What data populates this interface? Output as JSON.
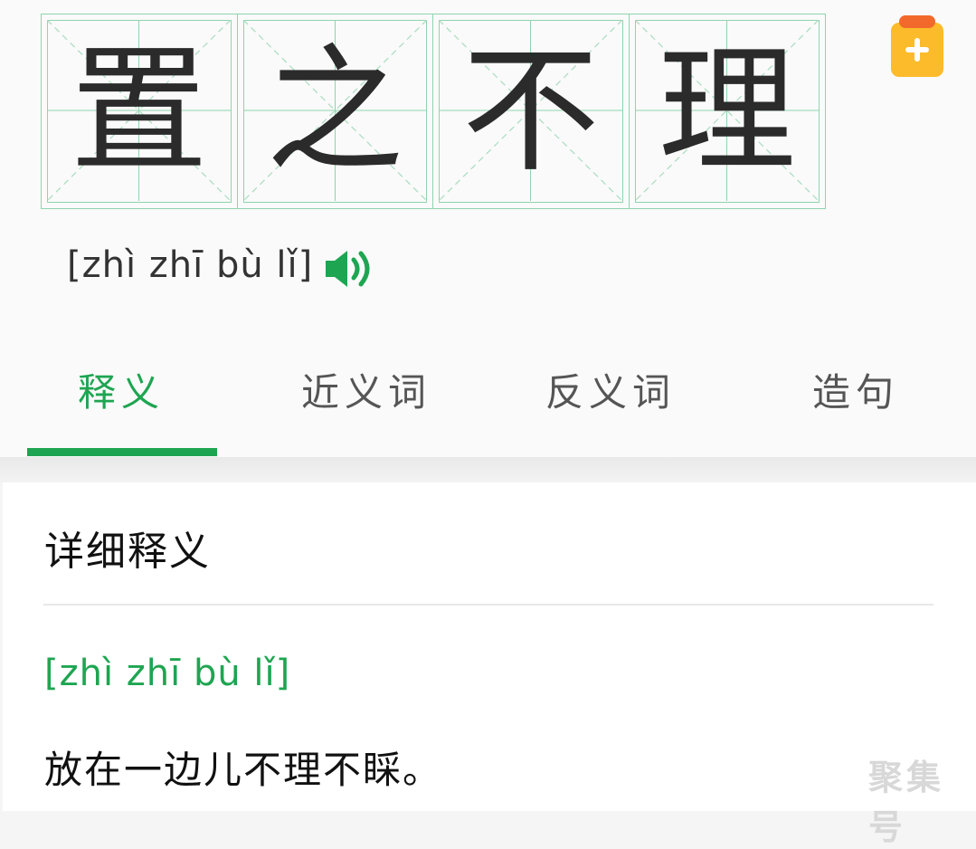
{
  "idiom": {
    "characters": [
      "置",
      "之",
      "不",
      "理"
    ],
    "pinyin": "[zhì zhī bù lǐ]"
  },
  "icons": {
    "add": "add-to-clipboard-icon",
    "speaker": "speaker-icon"
  },
  "tabs": [
    {
      "label": "释义",
      "active": true
    },
    {
      "label": "近义词",
      "active": false
    },
    {
      "label": "反义词",
      "active": false
    },
    {
      "label": "造句",
      "active": false
    }
  ],
  "detail": {
    "title": "详细释义",
    "pinyin": "[zhì zhī bù lǐ]",
    "definition": "放在一边儿不理不睬。"
  },
  "watermark": "聚集号",
  "colors": {
    "accent": "#1ea551",
    "grid": "#8fd4ae",
    "add_button": "#fcbb2b",
    "add_button_clip": "#f26a2b"
  }
}
